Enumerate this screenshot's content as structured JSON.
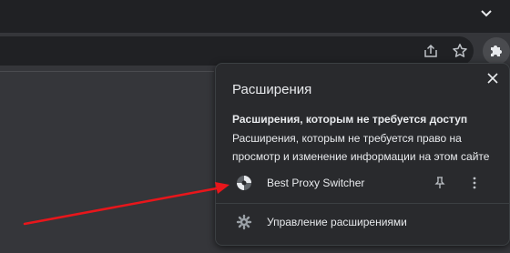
{
  "browser": {
    "tab_strip_button_icon": "chevron-down-icon",
    "toolbar_icons": [
      "share-icon",
      "star-icon",
      "puzzle-icon"
    ]
  },
  "extensions_popup": {
    "title": "Расширения",
    "close_icon": "close-icon",
    "section_heading": "Расширения, которым не требуется доступ",
    "section_description": "Расширения, которым не требуется право на просмотр и изменение информации на этом сайте",
    "extensions": [
      {
        "name": "Best Proxy Switcher",
        "icon": "proxy-switcher-icon",
        "pin_icon": "pin-icon",
        "menu_icon": "more-vert-icon"
      }
    ],
    "manage_label": "Управление расширениями",
    "manage_icon": "gear-icon"
  },
  "annotation": {
    "color": "#e8161b"
  },
  "colors": {
    "window_bg": "#202124",
    "toolbar_bg": "#35363a",
    "popup_bg": "#292a2d",
    "text": "#e8eaed",
    "icon": "#bdc1c6"
  }
}
